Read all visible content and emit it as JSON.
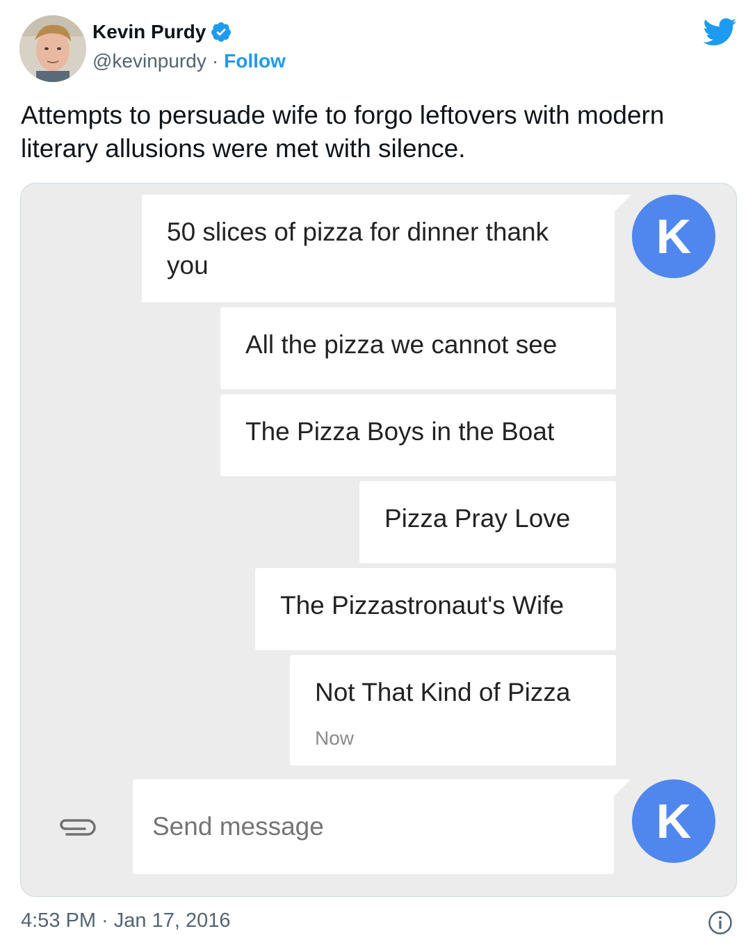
{
  "author": {
    "name": "Kevin Purdy",
    "handle": "@kevinpurdy",
    "separator": "·",
    "follow_label": "Follow",
    "verified_icon": "verified-badge-icon"
  },
  "brand_icon": "twitter-bird-icon",
  "tweet": {
    "text": "Attempts to persuade wife to forgo leftovers with modern literary allusions were met with silence."
  },
  "screenshot": {
    "messages": [
      {
        "text": "50 slices of pizza for dinner thank you"
      },
      {
        "text": "All the pizza we cannot see"
      },
      {
        "text": "The Pizza Boys in the Boat"
      },
      {
        "text": "Pizza Pray Love"
      },
      {
        "text": "The Pizzastronaut's Wife"
      },
      {
        "text": "Not That Kind of Pizza",
        "status": "Now"
      }
    ],
    "avatar_letter": "K",
    "compose": {
      "placeholder": "Send message",
      "attach_icon": "paperclip-icon"
    }
  },
  "footer": {
    "timestamp": "4:53 PM · Jan 17, 2016",
    "info_icon": "info-icon"
  },
  "colors": {
    "twitter_blue": "#1d9bf0",
    "avatar_blue": "#4f87ef",
    "chat_background": "#ececec"
  }
}
